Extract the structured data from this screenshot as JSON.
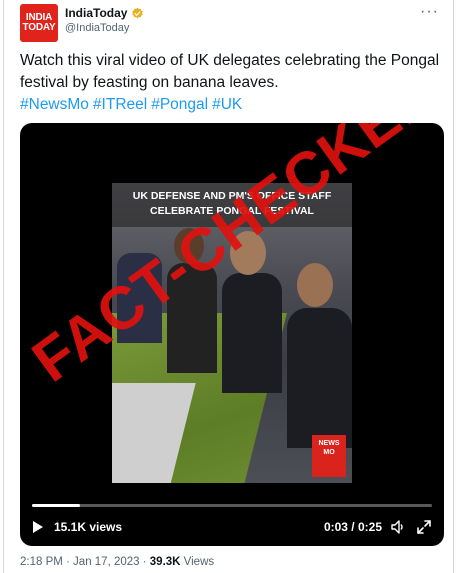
{
  "account": {
    "logo_line1": "INDIA",
    "logo_line2": "TODAY",
    "display_name": "IndiaToday",
    "handle": "@IndiaToday",
    "verified_color": "#e8b120"
  },
  "more_label": "···",
  "tweet": {
    "text": "Watch this viral video of UK delegates celebrating the Pongal festival by feasting on banana leaves.",
    "hashtags": [
      "#NewsMo",
      "#ITReel",
      "#Pongal",
      "#UK"
    ]
  },
  "video": {
    "banner_line1": "UK DEFENSE AND PM'S OFFICE STAFF",
    "banner_line2": "CELEBRATE PONGAL FESTIVAL",
    "stamp_text": "FACT-CHECKED",
    "watermark_line1": "NEWS",
    "watermark_line2": "MO",
    "views": "15.1K views",
    "time": "0:03 / 0:25",
    "progress_fraction": 0.12
  },
  "footer": {
    "time": "2:18 PM · Jan 17, 2023 · ",
    "views_count": "39.3K",
    "views_label": " Views"
  },
  "colors": {
    "link": "#1d9bf0",
    "brand_red": "#e0241b",
    "stamp_red": "#e0120f"
  }
}
